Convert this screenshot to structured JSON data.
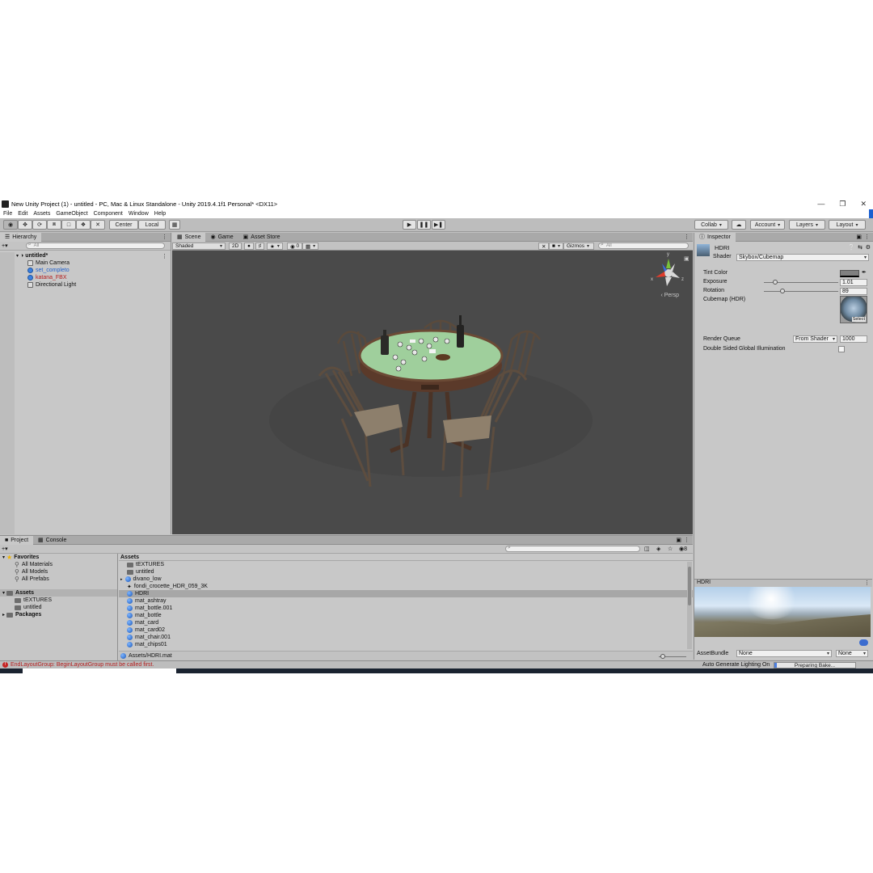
{
  "window": {
    "title": "New Unity Project (1) - untitled - PC, Mac & Linux Standalone - Unity 2019.4.1f1 Personal* <DX11>",
    "controls": [
      "—",
      "❐",
      "✕"
    ]
  },
  "menubar": [
    "File",
    "Edit",
    "Assets",
    "GameObject",
    "Component",
    "Window",
    "Help"
  ],
  "toolbar": {
    "pivot_center": "Center",
    "pivot_local": "Local",
    "collab": "Collab",
    "account": "Account",
    "layers": "Layers",
    "layout": "Layout"
  },
  "hierarchy": {
    "tab": "Hierarchy",
    "search_placeholder": "All",
    "scene_name": "untitled*",
    "items": [
      {
        "label": "Main Camera",
        "style": "normal"
      },
      {
        "label": "set_completo",
        "style": "blue"
      },
      {
        "label": "katana_FBX",
        "style": "red"
      },
      {
        "label": "Directional Light",
        "style": "normal"
      }
    ]
  },
  "scene": {
    "tabs": [
      "Scene",
      "Game",
      "Asset Store"
    ],
    "shading": "Shaded",
    "mode_2d": "2D",
    "fx_count": "0",
    "gizmos": "Gizmos",
    "search_placeholder": "All",
    "persp": "‹ Persp",
    "axis_x": "x",
    "axis_y": "y",
    "axis_z": "z"
  },
  "inspector": {
    "tab": "Inspector",
    "asset_name": "HDRI",
    "shader_label": "Shader",
    "shader_value": "Skybox/Cubemap",
    "tint_label": "Tint Color",
    "exposure_label": "Exposure",
    "exposure_value": "1.01",
    "exposure_fraction": 0.15,
    "rotation_label": "Rotation",
    "rotation_value": "89",
    "rotation_fraction": 0.25,
    "cubemap_label": "Cubemap   (HDR)",
    "select_label": "Select",
    "render_queue_label": "Render Queue",
    "render_queue_mode": "From Shader",
    "render_queue_value": "1000",
    "double_sided_label": "Double Sided Global Illumination",
    "preview_title": "HDRI",
    "assetbundle_label": "AssetBundle",
    "assetbundle_value": "None",
    "assetbundle_variant": "None"
  },
  "project": {
    "tabs": [
      "Project",
      "Console"
    ],
    "favorites_label": "Favorites",
    "favorites": [
      "All Materials",
      "All Models",
      "All Prefabs"
    ],
    "assets_label": "Assets",
    "asset_folders": [
      "tEXTURES",
      "untitled"
    ],
    "packages_label": "Packages",
    "breadcrumb": "Assets",
    "count": "8",
    "files": [
      {
        "name": "tEXTURES",
        "kind": "folder"
      },
      {
        "name": "untitled",
        "kind": "folder"
      },
      {
        "name": "divano_low",
        "kind": "model"
      },
      {
        "name": "fondi_crocette_HDR_059_3K",
        "kind": "texture"
      },
      {
        "name": "HDRI",
        "kind": "material",
        "selected": true
      },
      {
        "name": "mat_ashtray",
        "kind": "material"
      },
      {
        "name": "mat_bottle.001",
        "kind": "material"
      },
      {
        "name": "mat_bottle",
        "kind": "material"
      },
      {
        "name": "mat_card",
        "kind": "material"
      },
      {
        "name": "mat_card02",
        "kind": "material"
      },
      {
        "name": "mat_chair.001",
        "kind": "material"
      },
      {
        "name": "mat_chips01",
        "kind": "material"
      }
    ],
    "selected_path": "Assets/HDRI.mat"
  },
  "status": {
    "error": "EndLayoutGroup: BeginLayoutGroup must be called first.",
    "auto_lighting": "Auto Generate Lighting On",
    "bake": "Preparing Bake..."
  },
  "colors": {
    "table_felt": "#9fcf9c",
    "error_red": "#b51d1d",
    "link_blue": "#1f5fcc"
  }
}
